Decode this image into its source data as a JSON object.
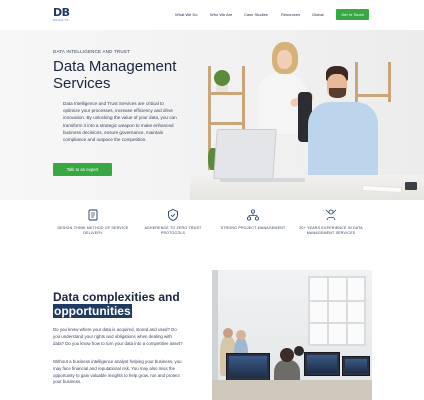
{
  "header": {
    "logo_mark": "DB",
    "logo_sub": "RESULTS",
    "nav": [
      "What We Do",
      "Who We Are",
      "Case Studies",
      "Resources",
      "Global"
    ],
    "cta": "Get In Touch"
  },
  "hero": {
    "kicker": "DATA INTELLIGENCE AND TRUST",
    "title": "Data Management Services",
    "body": "Data Intelligence and Trust Services are critical to optimize your processes, increase efficiency and drive innovation. By unlocking the value of your data, you can transform it into a strategic weapon to make enhanced business decisions, ensure governance, maintain compliance and outpace the competition.",
    "cta": "Talk to an expert"
  },
  "features": [
    {
      "icon": "document-stack-icon",
      "label": "DESIGN-THINK METHOD OF SERVICE DELIVERY"
    },
    {
      "icon": "shield-check-icon",
      "label": "ADHERENCE TO ZERO TRUST PROTOCOLS"
    },
    {
      "icon": "project-network-icon",
      "label": "STRONG PROJECT MANAGEMENT"
    },
    {
      "icon": "expert-people-icon",
      "label": "20+ YEARS EXPERIENCE IN DATA MANAGEMENT SERVICES"
    }
  ],
  "section2": {
    "title_line1": "Data complexities and",
    "title_line2": "opportunities",
    "p1": "Do you know where your data is acquired, stored and used? Do you understand your rights and obligations when dealing with data? Do you know how to turn your data into a competitive asset?",
    "p2": "Without a business intelligence analyst helping your business, you may face financial and reputational risk. You may also miss the opportunity to gain valuable insights to help grow, run and protect your business."
  },
  "colors": {
    "brand_navy": "#1f3a63",
    "accent_green": "#38a843",
    "text_dark": "#1a2540"
  }
}
